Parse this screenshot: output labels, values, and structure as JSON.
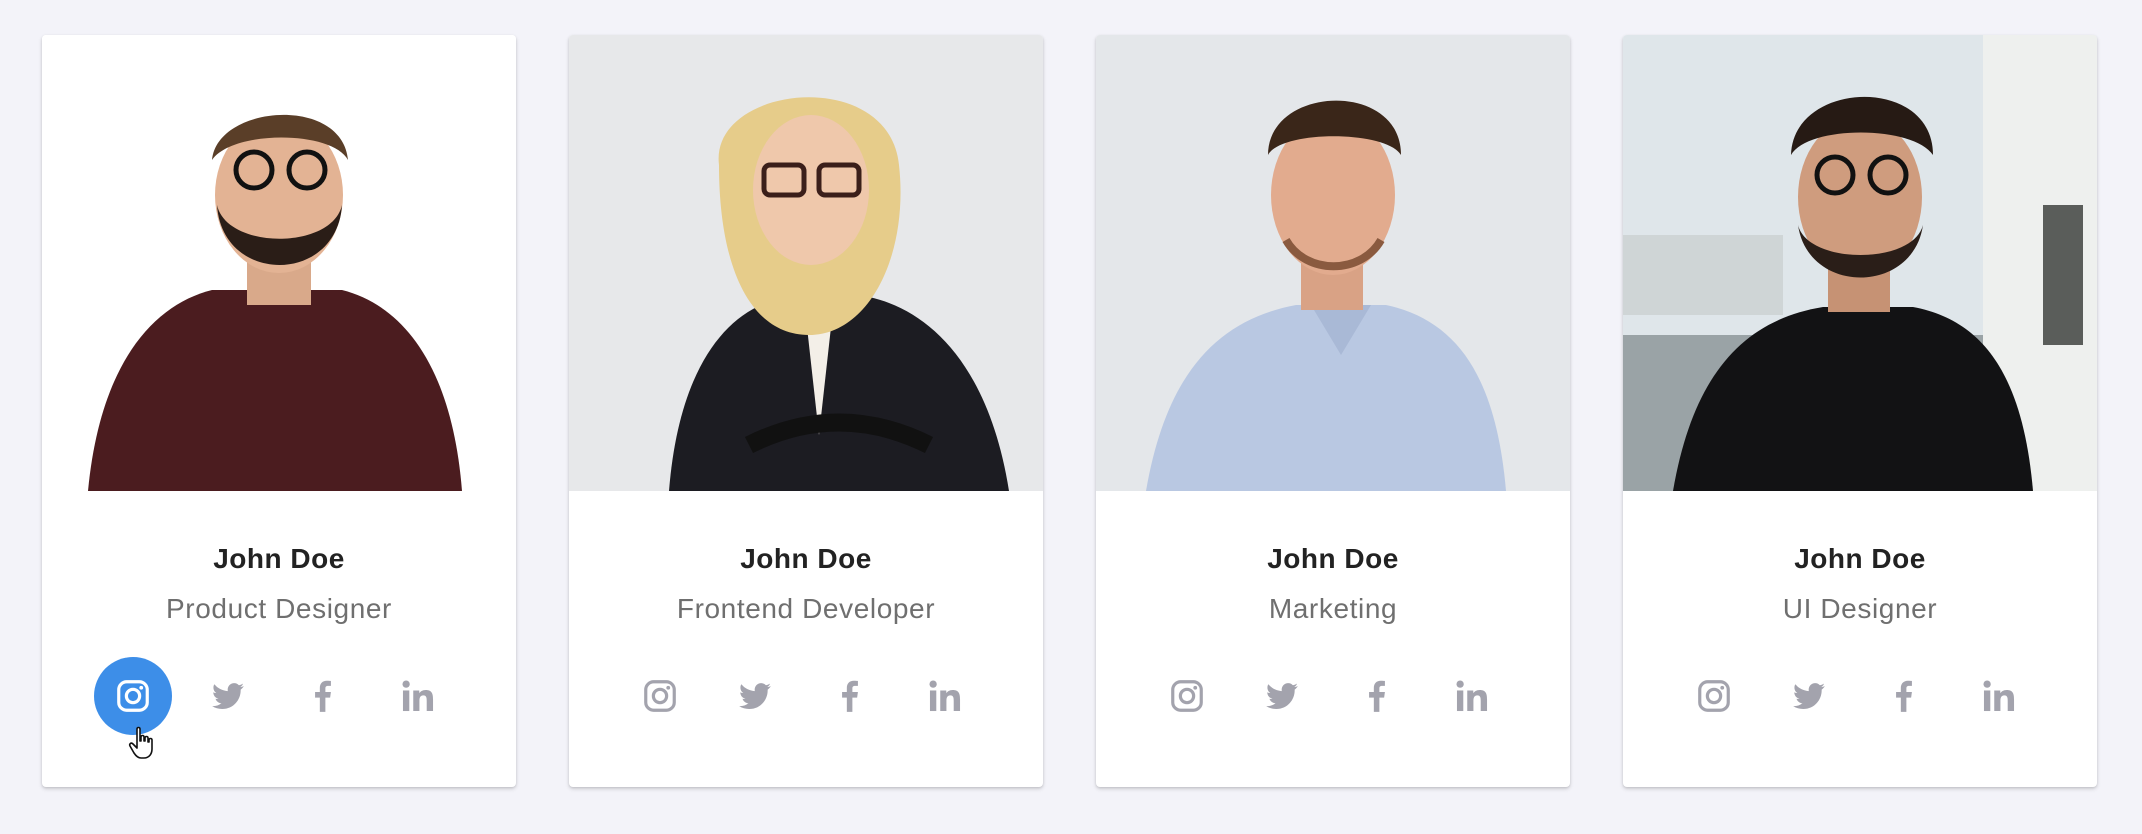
{
  "team": [
    {
      "name": "John Doe",
      "role": "Product Designer",
      "photo_desc": "bearded-man-glasses-maroon-shirt"
    },
    {
      "name": "John Doe",
      "role": "Frontend Developer",
      "photo_desc": "blonde-woman-black-blazer"
    },
    {
      "name": "John Doe",
      "role": "Marketing",
      "photo_desc": "smiling-man-light-blue-shirt"
    },
    {
      "name": "John Doe",
      "role": "UI Designer",
      "photo_desc": "bearded-man-glasses-black-tshirt"
    }
  ],
  "social_icons": [
    "instagram-icon",
    "twitter-icon",
    "facebook-icon",
    "linkedin-icon"
  ],
  "active_social": {
    "card": 0,
    "icon": "instagram-icon"
  },
  "colors": {
    "page_bg": "#f3f3f9",
    "card_bg": "#ffffff",
    "name_text": "#222222",
    "role_text": "#6f6f6f",
    "icon_default": "#a3a3ad",
    "icon_active_bg": "#3d8ee8"
  }
}
